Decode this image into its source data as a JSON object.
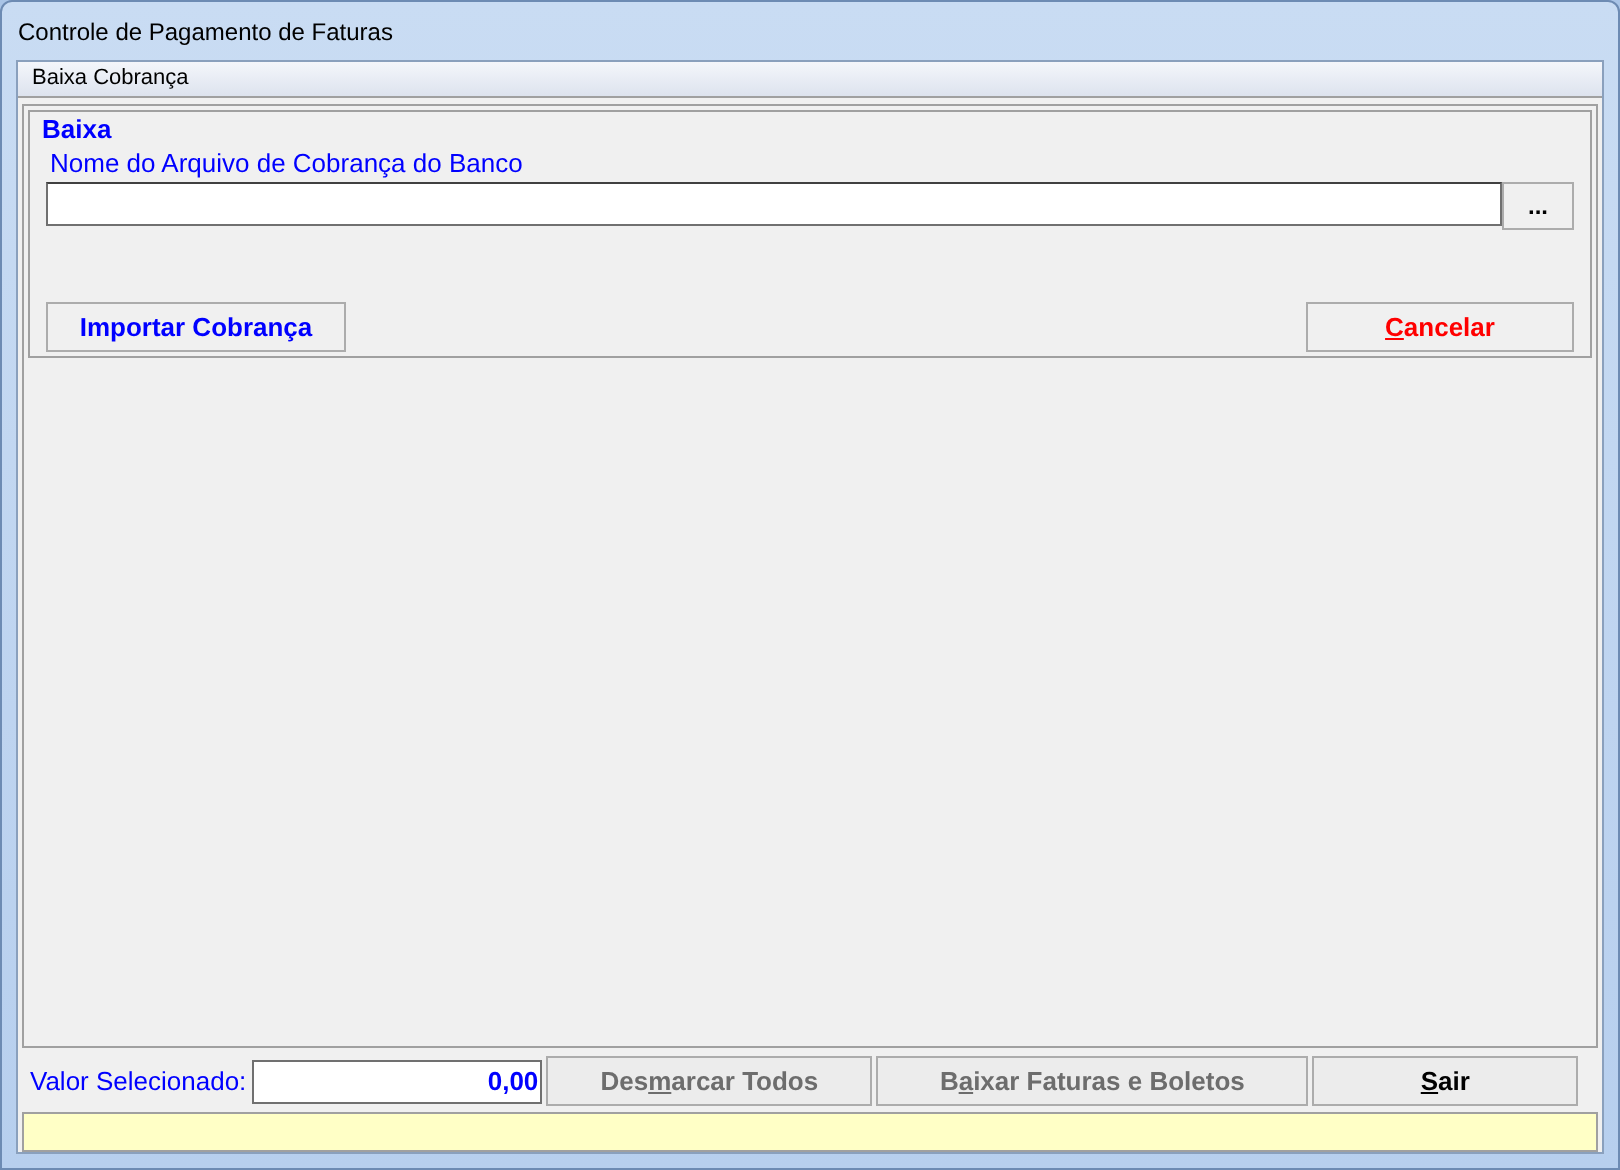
{
  "window": {
    "title": "Controle de Pagamento de Faturas"
  },
  "tab": {
    "label": "Baixa Cobrança"
  },
  "group": {
    "title": "Baixa",
    "file_label": "Nome do Arquivo de Cobrança do Banco",
    "browse_button": "...",
    "import_button": {
      "post": "Importar Cobrança",
      "disabled": false,
      "color": "#0000ff"
    },
    "cancel_button": {
      "key": "C",
      "post": "ancelar",
      "disabled": false,
      "color": "#ff0000"
    }
  },
  "footer": {
    "total_label": "Valor Selecionado:",
    "total_value": "0,00",
    "buttons": [
      {
        "pre": "Des",
        "key": "m",
        "post": "arcar Todos",
        "disabled": true
      },
      {
        "pre": "B",
        "key": "a",
        "post": "ixar Faturas e Boletos",
        "disabled": true
      },
      {
        "key": "S",
        "post": "air",
        "disabled": false
      }
    ]
  }
}
